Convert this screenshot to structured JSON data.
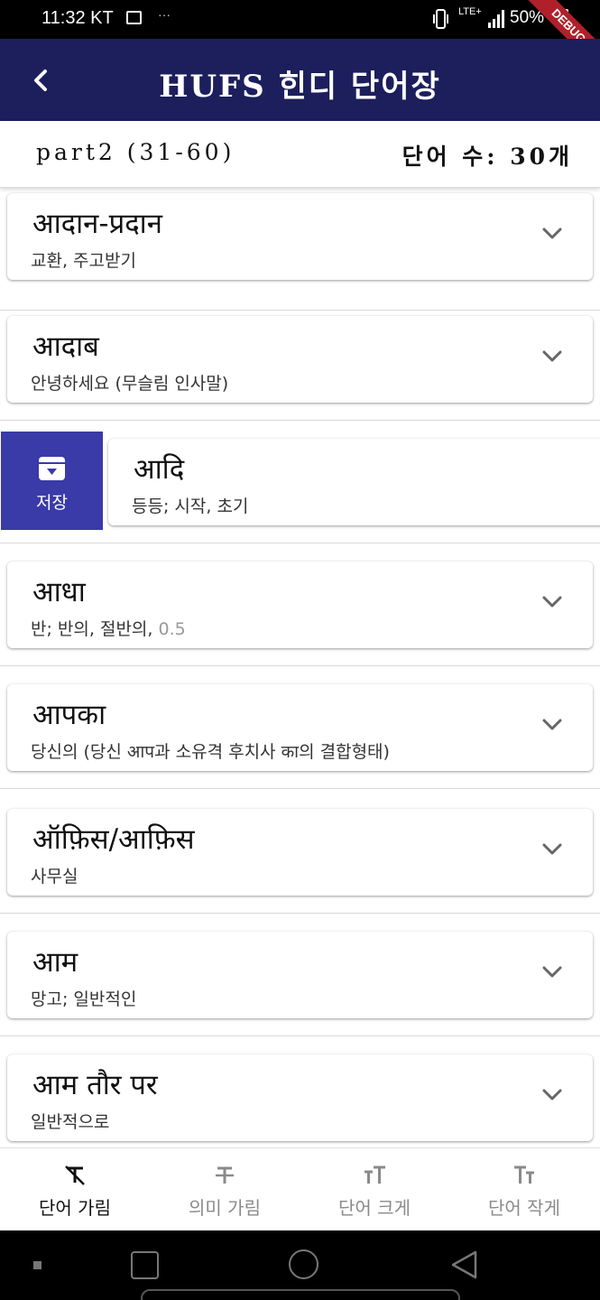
{
  "status_bar": {
    "time": "11:32 KT",
    "dots": "···",
    "lte": "LTE+",
    "battery": "50%",
    "debug": "DEBUG"
  },
  "app_bar": {
    "title": "HUFS 힌디 단어장"
  },
  "sub_header": {
    "part": "part2 (31-60)",
    "word_count": "단어 수: 30개"
  },
  "words": [
    {
      "hindi": "आदान-प्रदान",
      "meaning": "교환, 주고받기"
    },
    {
      "hindi": "आदाब",
      "meaning": "안녕하세요 (무슬림 인사말)"
    },
    {
      "hindi": "आदि",
      "meaning": "등등; 시작, 초기"
    },
    {
      "hindi": "आधा",
      "meaning": "반; 반의, 절반의, ",
      "meaning_dim": "0.5"
    },
    {
      "hindi": "आपका",
      "meaning": "당신의 (당신 आप과 소유격 후치사 का의 결합형태)"
    },
    {
      "hindi": "ऑफ़िस/आफ़िस",
      "meaning": "사무실"
    },
    {
      "hindi": "आम",
      "meaning": "망고; 일반적인"
    },
    {
      "hindi": "आम तौर पर",
      "meaning": "일반적으로"
    }
  ],
  "swipe_action": {
    "label": "저장",
    "icon": "archive-icon"
  },
  "bottom_bar": {
    "items": [
      {
        "label": "단어 가림",
        "icon": "hide-word-icon",
        "active": true
      },
      {
        "label": "의미 가림",
        "icon": "hide-meaning-icon",
        "active": false
      },
      {
        "label": "단어 크게",
        "icon": "text-larger-icon",
        "active": false
      },
      {
        "label": "단어 작게",
        "icon": "text-smaller-icon",
        "active": false
      }
    ]
  },
  "colors": {
    "app_bar": "#1c1f5c",
    "save_action": "#3a3aa8"
  }
}
